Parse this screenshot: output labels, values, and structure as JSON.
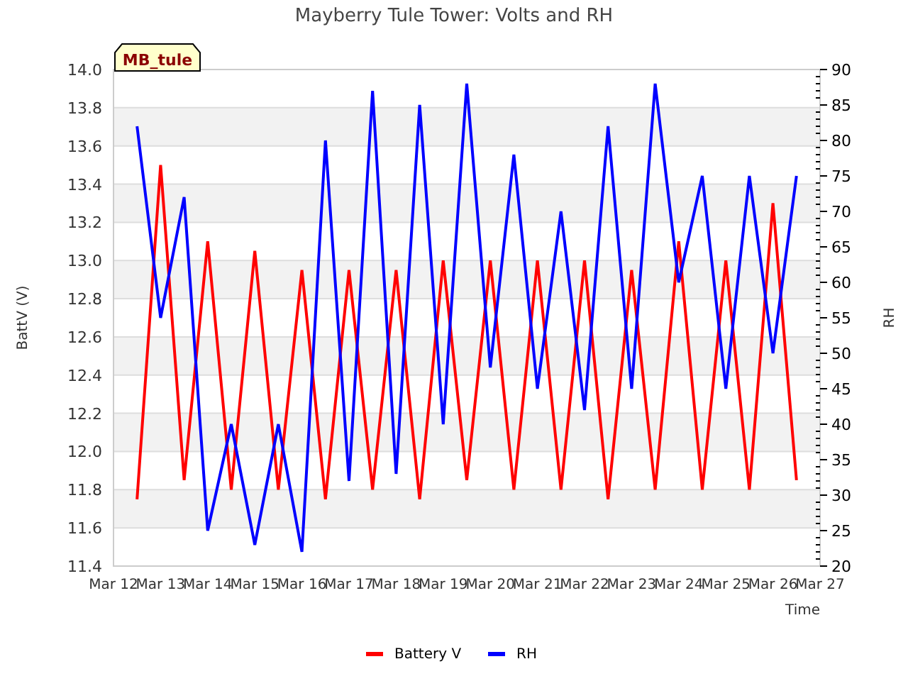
{
  "title": "Mayberry Tule Tower: Volts and RH",
  "site_tag": "MB_tule",
  "chart_data": {
    "type": "line",
    "xlabel": "Time",
    "ylabel": "BattV (V)",
    "y2label": "RH",
    "grid": true,
    "legend": "bottom",
    "ylim": [
      11.4,
      14.0
    ],
    "y2lim": [
      20,
      90
    ],
    "categories": [
      "Mar 12",
      null,
      "Mar 13",
      null,
      "Mar 14",
      null,
      "Mar 15",
      null,
      "Mar 16",
      null,
      "Mar 17",
      null,
      "Mar 18",
      null,
      "Mar 19",
      null,
      "Mar 20",
      null,
      "Mar 21",
      null,
      "Mar 22",
      null,
      "Mar 23",
      null,
      "Mar 24",
      null,
      "Mar 25",
      null,
      "Mar 26",
      null,
      "Mar 27"
    ],
    "yticks": [
      {
        "value": 11.4,
        "label": "11.4"
      },
      {
        "value": 11.6,
        "label": "11.6"
      },
      {
        "value": 11.8,
        "label": "11.8"
      },
      {
        "value": 12.0,
        "label": "12.0"
      },
      {
        "value": 12.2,
        "label": "12.2"
      },
      {
        "value": 12.4,
        "label": "12.4"
      },
      {
        "value": 12.6,
        "label": "12.6"
      },
      {
        "value": 12.8,
        "label": "12.8"
      },
      {
        "value": 13.0,
        "label": "13.0"
      },
      {
        "value": 13.2,
        "label": "13.2"
      },
      {
        "value": 13.4,
        "label": "13.4"
      },
      {
        "value": 13.6,
        "label": "13.6"
      },
      {
        "value": 13.8,
        "label": "13.8"
      },
      {
        "value": 14.0,
        "label": "14.0"
      }
    ],
    "y2ticks": [
      20,
      25,
      30,
      35,
      40,
      45,
      50,
      55,
      60,
      65,
      70,
      75,
      80,
      85,
      90
    ],
    "series": [
      {
        "name": "Battery V",
        "color": "#ff0000",
        "axis": "y",
        "values": [
          null,
          11.75,
          13.5,
          11.85,
          13.1,
          11.8,
          13.05,
          11.8,
          12.95,
          11.75,
          12.95,
          11.8,
          12.95,
          11.75,
          13.0,
          11.85,
          13.0,
          11.8,
          13.0,
          11.8,
          13.0,
          11.75,
          12.95,
          11.8,
          13.1,
          11.8,
          13.0,
          11.8,
          13.3,
          11.85,
          null
        ]
      },
      {
        "name": "RH",
        "color": "#0000ff",
        "axis": "y2",
        "values": [
          null,
          82,
          55,
          72,
          25,
          40,
          23,
          40,
          22,
          80,
          32,
          87,
          33,
          85,
          40,
          88,
          48,
          78,
          45,
          70,
          42,
          82,
          45,
          88,
          60,
          75,
          45,
          75,
          50,
          75,
          null
        ]
      }
    ]
  }
}
